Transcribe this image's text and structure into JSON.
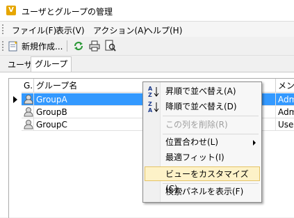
{
  "window": {
    "title": "ユーザとグループの管理",
    "app_icon": "V"
  },
  "menubar": {
    "items": [
      "ファイル(F)",
      "表示(V)",
      "アクション(A)",
      "ヘルプ(H)"
    ]
  },
  "toolbar": {
    "new_label": "新規作成..."
  },
  "tabs": [
    {
      "label": "ユーザ"
    },
    {
      "label": "グループ"
    }
  ],
  "grid": {
    "columns": [
      "G.",
      "グループ名",
      "メンバ"
    ],
    "rows": [
      {
        "name": "GroupA",
        "member": "Adm",
        "selected": true
      },
      {
        "name": "GroupB",
        "member": "Adm",
        "selected": false
      },
      {
        "name": "GroupC",
        "member": "User",
        "selected": false
      }
    ]
  },
  "context_menu": {
    "items": [
      {
        "label": "昇順で並べ替え(A)",
        "icon": "sort-ascending-icon"
      },
      {
        "label": "降順で並べ替え(D)",
        "icon": "sort-descending-icon"
      },
      {
        "label": "この列を削除(R)",
        "disabled": true
      },
      {
        "label": "位置合わせ(L)",
        "submenu": true
      },
      {
        "label": "最適フィット(I)"
      },
      {
        "label": "ビューをカスタマイズ(C)...",
        "highlighted": true
      },
      {
        "label": "検索パネルを表示(F)"
      }
    ]
  },
  "colors": {
    "selection": "#3399ff",
    "menu_highlight": "#fdf2c8"
  }
}
